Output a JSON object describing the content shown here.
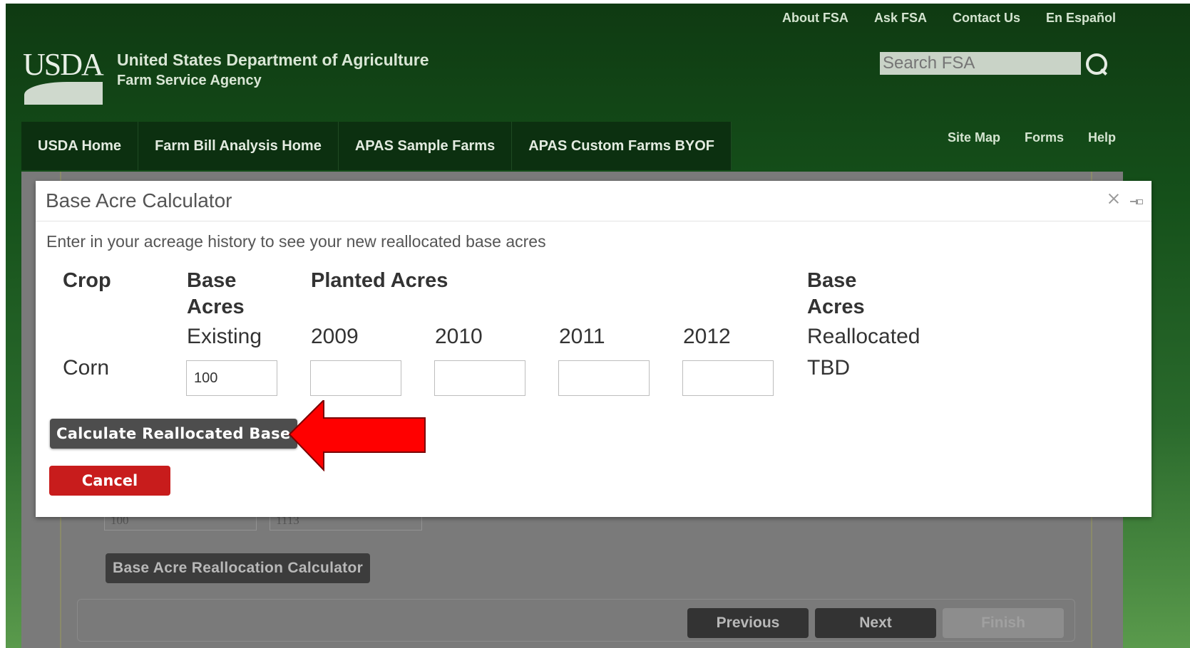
{
  "header": {
    "top_links": [
      "About FSA",
      "Ask FSA",
      "Contact Us",
      "En Español"
    ],
    "logo_text": "USDA",
    "agency_line1": "United States Department of Agriculture",
    "agency_line2": "Farm Service Agency",
    "search_placeholder": "Search FSA",
    "nav_tabs": [
      "USDA Home",
      "Farm Bill Analysis Home",
      "APAS Sample Farms",
      "APAS Custom Farms BYOF"
    ],
    "util_links": [
      "Site Map",
      "Forms",
      "Help"
    ]
  },
  "background_page": {
    "field1_value": "100",
    "field2_value": "1113",
    "calculator_button": "Base Acre Reallocation Calculator",
    "previous_button": "Previous",
    "next_button": "Next",
    "finish_button": "Finish"
  },
  "modal": {
    "title": "Base Acre Calculator",
    "intro": "Enter in your acreage history to see your new reallocated base acres",
    "headers": {
      "crop": "Crop",
      "base_acres_line1": "Base",
      "base_acres_line2": "Acres",
      "planted_acres": "Planted Acres",
      "base_acres_realloc_line1": "Base",
      "base_acres_realloc_line2": "Acres"
    },
    "subheaders": {
      "existing": "Existing",
      "y2009": "2009",
      "y2010": "2010",
      "y2011": "2011",
      "y2012": "2012",
      "reallocated": "Reallocated"
    },
    "row": {
      "crop": "Corn",
      "existing_value": "100",
      "y2009_value": "",
      "y2010_value": "",
      "y2011_value": "",
      "y2012_value": "",
      "reallocated": "TBD"
    },
    "calculate_button": "Calculate Reallocated Base",
    "cancel_button": "Cancel"
  },
  "annotation": {
    "arrow_color": "#ff0000"
  }
}
